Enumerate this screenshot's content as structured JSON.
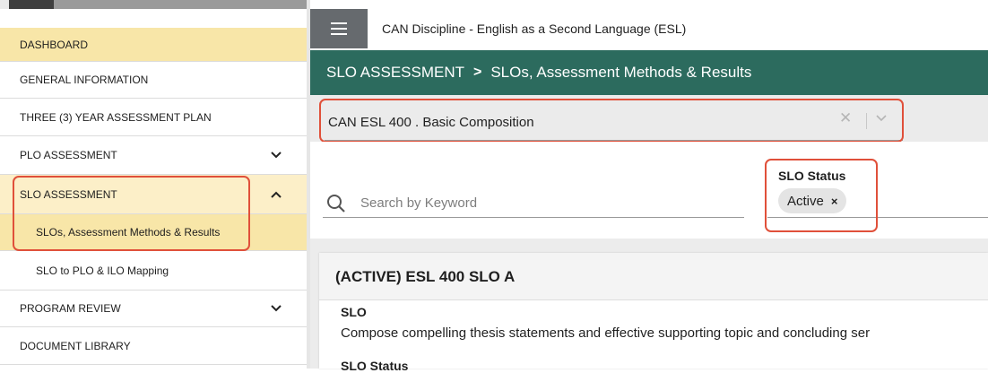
{
  "sidebar": {
    "items": [
      {
        "label": "DASHBOARD"
      },
      {
        "label": "GENERAL INFORMATION"
      },
      {
        "label": "THREE (3) YEAR ASSESSMENT PLAN"
      },
      {
        "label": "PLO ASSESSMENT"
      },
      {
        "label": "SLO ASSESSMENT"
      },
      {
        "label": "SLOs, Assessment Methods & Results"
      },
      {
        "label": "SLO to PLO & ILO Mapping"
      },
      {
        "label": "PROGRAM REVIEW"
      },
      {
        "label": "DOCUMENT LIBRARY"
      }
    ]
  },
  "header": {
    "title": "CAN Discipline - English as a Second Language (ESL)"
  },
  "breadcrumb": {
    "section": "SLO ASSESSMENT",
    "separator": ">",
    "page": "SLOs, Assessment Methods & Results"
  },
  "course_select": {
    "value": "CAN ESL 400 . Basic Composition"
  },
  "filters": {
    "search_placeholder": "Search by Keyword",
    "status_label": "SLO Status",
    "status_chip": "Active",
    "chip_remove": "×"
  },
  "slo_card": {
    "title": "(ACTIVE) ESL 400 SLO A",
    "slo_label": "SLO",
    "slo_text": "Compose compelling thesis statements and effective supporting topic and concluding ser",
    "status_label": "SLO Status"
  },
  "colors": {
    "accent_green": "#2c6b5e",
    "highlight_yellow": "#f8e6a8",
    "annotation_red": "#e0503a",
    "hamburger_bg": "#666a6e"
  },
  "icons": [
    "hamburger-icon",
    "chevron-down-icon",
    "chevron-up-icon",
    "clear-icon",
    "search-icon"
  ]
}
